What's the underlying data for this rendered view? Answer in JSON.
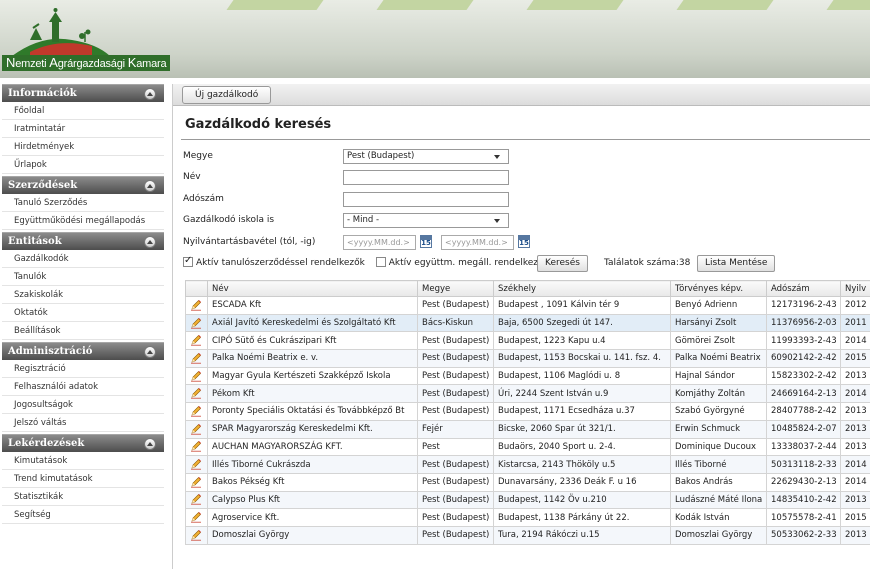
{
  "header": {
    "logo": {
      "icon": "farm-logo-icon",
      "text_parts": [
        "N",
        "emzeti ",
        "A",
        "grárgazdasági ",
        "K",
        "amara"
      ],
      "text": "Nemzeti Agrárgazdasági Kamara"
    }
  },
  "sidebar": {
    "sections": [
      {
        "title": "Információk",
        "items": [
          "Főoldal",
          "Iratmintatár",
          "Hirdetmények",
          "Űrlapok"
        ]
      },
      {
        "title": "Szerződések",
        "items": [
          "Tanuló Szerződés",
          "Együttműködési megállapodás"
        ]
      },
      {
        "title": "Entitások",
        "items": [
          "Gazdálkodók",
          "Tanulók",
          "Szakiskolák",
          "Oktatók",
          "Beállítások"
        ]
      },
      {
        "title": "Adminisztráció",
        "items": [
          "Regisztráció",
          "Felhasználói adatok",
          "Jogosultságok",
          "Jelszó váltás"
        ]
      },
      {
        "title": "Lekérdezések",
        "items": [
          "Kimutatások",
          "Trend kimutatások",
          "Statisztikák",
          "Segítség"
        ]
      }
    ]
  },
  "toolbar": {
    "new_label": "Új gazdálkodó"
  },
  "form": {
    "title": "Gazdálkodó keresés",
    "county_label": "Megye",
    "county_value": "Pest (Budapest)",
    "name_label": "Név",
    "name_value": "",
    "tax_label": "Adószám",
    "tax_value": "",
    "school_label": "Gazdálkodó iskola is",
    "school_value": "- Mind -",
    "date_label": "Nyilvántartásbavétel (tól, -ig)",
    "date_from_placeholder": "<yyyy.MM.dd.>",
    "date_to_placeholder": "<yyyy.MM.dd.>",
    "cal_label": "15",
    "active_contract_label": "Aktív tanulószerződéssel rendelkezők",
    "active_contract_checked": true,
    "active_coop_label": "Aktív együttm. megáll. rendelkezők",
    "active_coop_checked": false,
    "search_label": "Keresés",
    "results_label": "Találatok száma:",
    "results_count": "38",
    "save_list_label": "Lista Mentése"
  },
  "table": {
    "columns": [
      "",
      "Név",
      "Megye",
      "Székhely",
      "Törvényes képv.",
      "Adószám",
      "Nyilv"
    ],
    "rows": [
      [
        "ESCADA Kft",
        "Pest (Budapest)",
        "Budapest , 1091 Kálvin tér 9",
        "Benyó Adrienn",
        "12173196-2-43",
        "2012"
      ],
      [
        "Axiál Javító Kereskedelmi és Szolgáltató Kft",
        "Bács-Kiskun",
        "Baja, 6500 Szegedi út 147.",
        "Harsányi Zsolt",
        "11376956-2-03",
        "2011"
      ],
      [
        "CIPÓ Sütő és Cukrászipari Kft",
        "Pest (Budapest)",
        "Budapest, 1223 Kapu u.4",
        "Gömörei Zsolt",
        "11993393-2-43",
        "2014"
      ],
      [
        "Palka Noémi Beatrix e. v.",
        "Pest (Budapest)",
        "Budapest, 1153 Bocskai u. 141. fsz. 4.",
        "Palka Noémi Beatrix",
        "60902142-2-42",
        "2015"
      ],
      [
        "Magyar Gyula Kertészeti Szakképző Iskola",
        "Pest (Budapest)",
        "Budapest, 1106 Maglódi u. 8",
        "Hajnal Sándor",
        "15823302-2-42",
        "2013"
      ],
      [
        "Pékom Kft",
        "Pest (Budapest)",
        "Úri, 2244 Szent István u.9",
        "Komjáthy Zoltán",
        "24669164-2-13",
        "2014"
      ],
      [
        "Poronty Speciális Oktatási  és Továbbképző Bt",
        "Pest (Budapest)",
        "Budapest, 1171 Ecsedháza u.37",
        "Szabó Györgyné",
        "28407788-2-42",
        "2013"
      ],
      [
        "SPAR Magyarország Kereskedelmi Kft.",
        "Fejér",
        "Bicske, 2060 Spar út 321/1.",
        "Erwin Schmuck",
        "10485824-2-07",
        "2013"
      ],
      [
        "AUCHAN MAGYARORSZÁG KFT.",
        "Pest",
        "Budaörs, 2040 Sport u. 2-4.",
        "Dominique Ducoux",
        "13338037-2-44",
        "2013"
      ],
      [
        "Illés Tiborné Cukrászda",
        "Pest (Budapest)",
        "Kistarcsa, 2143 Thököly u.5",
        "Illés Tiborné",
        "50313118-2-33",
        "2014"
      ],
      [
        "Bakos Pékség Kft",
        "Pest (Budapest)",
        "Dunavarsány, 2336 Deák F. u 16",
        "Bakos András",
        "22629430-2-13",
        "2014"
      ],
      [
        "Calypso Plus Kft",
        "Pest (Budapest)",
        "Budapest, 1142 Öv u.210",
        "Ludászné Máté Ilona",
        "14835410-2-42",
        "2013"
      ],
      [
        "Agroservice Kft.",
        "Pest (Budapest)",
        "Budapest, 1138 Párkány út 22.",
        "Kodák István",
        "10575578-2-41",
        "2015"
      ],
      [
        "Domoszlai György",
        "Pest (Budapest)",
        "Tura, 2194 Rákóczi u.15",
        "Domoszlai György",
        "50533062-2-33",
        "2013"
      ]
    ]
  },
  "colors": {
    "accent": "#2f6e2a",
    "section_header": "#5a5a5a",
    "row_selected": "#e2edf7"
  }
}
